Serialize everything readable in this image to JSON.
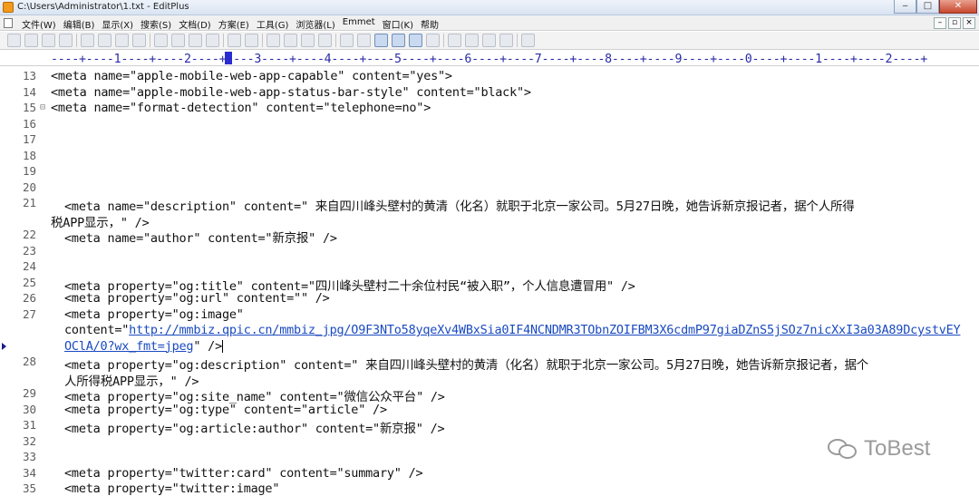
{
  "window": {
    "title": "C:\\Users\\Administrator\\1.txt - EditPlus",
    "min": "‒",
    "max": "□",
    "close": "✕"
  },
  "menu": {
    "items": [
      "文件(W)",
      "编辑(B)",
      "显示(X)",
      "搜索(S)",
      "文档(D)",
      "方案(E)",
      "工具(G)",
      "浏览器(L)",
      "Emmet",
      "窗口(K)",
      "帮助"
    ],
    "mdi_buttons": [
      "–",
      "▫",
      "×"
    ]
  },
  "ruler": {
    "text": "----+----1----+----2----+----3----+----4----+----5----+----6----+----7----+----8----+----9----+----0----+----1----+----2----+"
  },
  "lines": [
    {
      "num": "13",
      "text": "<meta name=\"apple-mobile-web-app-capable\" content=\"yes\">"
    },
    {
      "num": "14",
      "text": "<meta name=\"apple-mobile-web-app-status-bar-style\" content=\"black\">"
    },
    {
      "num": "15",
      "text": "<meta name=\"format-detection\" content=\"telephone=no\">"
    },
    {
      "num": "16",
      "text": ""
    },
    {
      "num": "17",
      "text": ""
    },
    {
      "num": "18",
      "text": ""
    },
    {
      "num": "19",
      "text": ""
    },
    {
      "num": "20",
      "text": ""
    },
    {
      "num": "21",
      "text": "<meta name=\"description\" content=\" 来自四川峰头壁村的黄清（化名）就职于北京一家公司。5月27日晚，她告诉新京报记者，据个人所得"
    },
    {
      "num": "",
      "text": "税APP显示，\" />"
    },
    {
      "num": "22",
      "text": "<meta name=\"author\" content=\"新京报\" />"
    },
    {
      "num": "23",
      "text": ""
    },
    {
      "num": "24",
      "text": ""
    },
    {
      "num": "25",
      "text": "<meta property=\"og:title\" content=\"四川峰头壁村二十余位村民“被入职”，个人信息遭冒用\" />"
    },
    {
      "num": "26",
      "text": "<meta property=\"og:url\" content=\"\" />"
    },
    {
      "num": "27",
      "text": "<meta property=\"og:image\""
    },
    {
      "num": "",
      "text": "content=\""
    },
    {
      "num": "",
      "text": ""
    },
    {
      "num": "28",
      "text": "<meta property=\"og:description\" content=\" 来自四川峰头壁村的黄清（化名）就职于北京一家公司。5月27日晚，她告诉新京报记者，据个"
    },
    {
      "num": "",
      "text": "人所得税APP显示，\" />"
    },
    {
      "num": "29",
      "text": "<meta property=\"og:site_name\" content=\"微信公众平台\" />"
    },
    {
      "num": "30",
      "text": "<meta property=\"og:type\" content=\"article\" />"
    },
    {
      "num": "31",
      "text": "<meta property=\"og:article:author\" content=\"新京报\" />"
    },
    {
      "num": "32",
      "text": ""
    },
    {
      "num": "33",
      "text": ""
    },
    {
      "num": "34",
      "text": "<meta property=\"twitter:card\" content=\"summary\" />"
    },
    {
      "num": "35",
      "text": "<meta property=\"twitter:image\""
    }
  ],
  "link_part1": "http://mmbiz.qpic.cn/mmbiz_jpg/O9F3NTo58yqeXv4WBxSia0IF4NCNDMR3TObnZOIFBM3X6cdmP97giaDZnS5jSOz7nicXxI3a03A89DcystvEY",
  "link_part2": "OClA/0?wx_fmt=jpeg",
  "link_suffix": "\" />",
  "watermark": "ToBest"
}
